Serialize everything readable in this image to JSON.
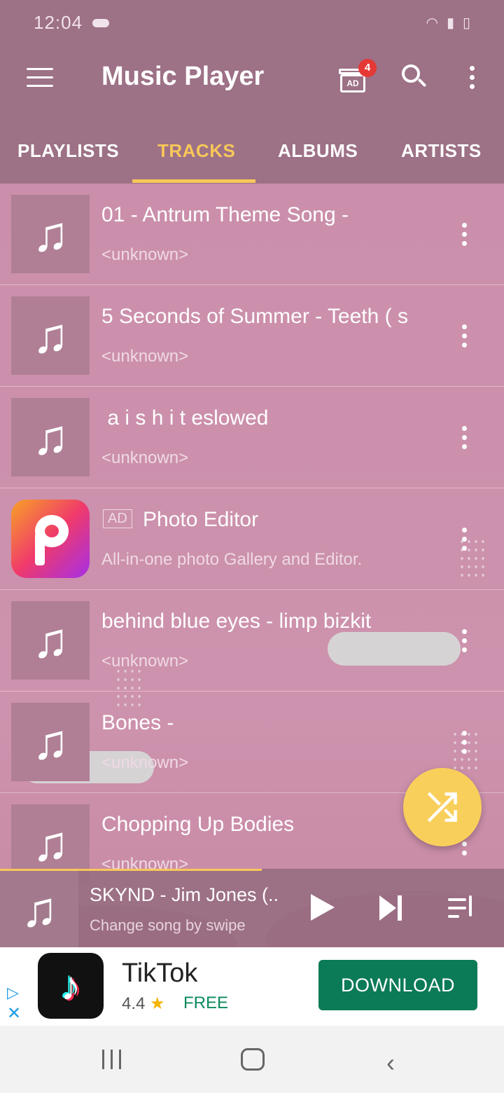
{
  "status_bar": {
    "time": "12:04",
    "icons": [
      "cloud-icon",
      "wifi-icon",
      "signal-icon",
      "battery-icon"
    ]
  },
  "app_bar": {
    "title": "Music Player",
    "ad_gift_badge": "4",
    "ad_gift_label": "AD"
  },
  "tabs": [
    {
      "label": "PLAYLISTS",
      "active": false
    },
    {
      "label": "TRACKS",
      "active": true
    },
    {
      "label": "ALBUMS",
      "active": false
    },
    {
      "label": "ARTISTS",
      "active": false
    }
  ],
  "tracks": [
    {
      "title": "01 - Antrum Theme Song -",
      "subtitle": "<unknown>"
    },
    {
      "title": "5 Seconds of Summer - Teeth ( s",
      "subtitle": "<unknown>"
    },
    {
      "title": " a i s h i t eslowed",
      "subtitle": "<unknown>"
    },
    {
      "ad_tag": "AD",
      "title": "Photo Editor",
      "subtitle": "All-in-one photo Gallery and Editor."
    },
    {
      "title": "behind blue eyes - limp bizkit",
      "subtitle": "<unknown>"
    },
    {
      "title": "Bones -",
      "subtitle": "<unknown>"
    },
    {
      "title": "Chopping Up Bodies",
      "subtitle": "<unknown>"
    }
  ],
  "now_playing": {
    "song": "SKYND - Jim Jones (..",
    "hint": "Change song by swipe",
    "progress": 0.52
  },
  "ad_banner": {
    "app_name": "TikTok",
    "rating": "4.4",
    "price": "FREE",
    "cta": "DOWNLOAD"
  },
  "colors": {
    "accent": "#f7c75a",
    "appbar": "#9d7186",
    "list_bg": "#cc8ea8",
    "cta": "#0b7a56"
  }
}
